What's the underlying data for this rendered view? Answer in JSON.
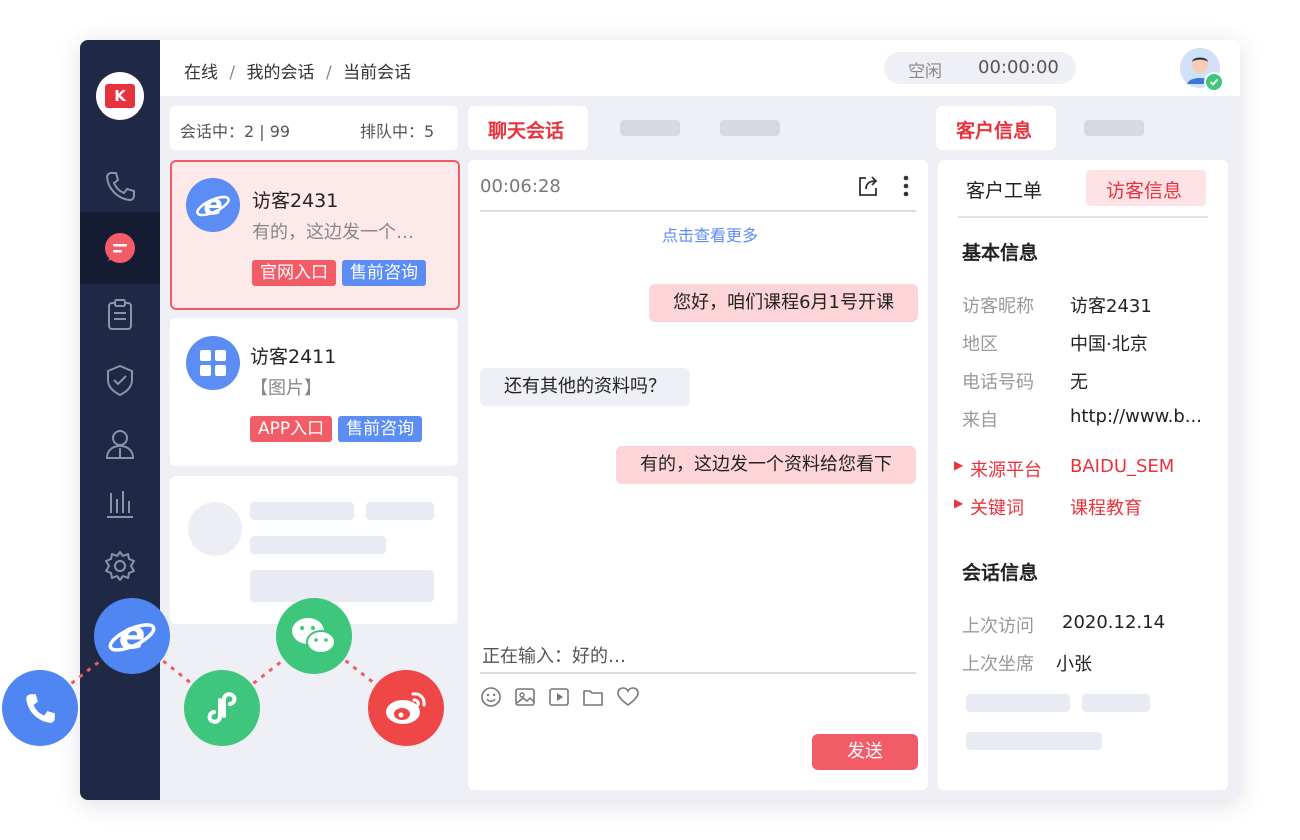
{
  "breadcrumb": {
    "item1": "在线",
    "sep1": "/",
    "item2": "我的会话",
    "sep2": "/",
    "item3": "当前会话"
  },
  "status": {
    "state": "空闲",
    "timer": "00:00:00"
  },
  "queue": {
    "in_session": "会话中：2 | 99",
    "queueing": "排队中：5"
  },
  "sessions": [
    {
      "name": "访客2431",
      "preview": "有的，这边发一个…",
      "tags": [
        "官网入口",
        "售前咨询"
      ]
    },
    {
      "name": "访客2411",
      "preview": "【图片】",
      "tags": [
        "APP入口",
        "售前咨询"
      ]
    }
  ],
  "chat_tabs": {
    "active": "聊天会话"
  },
  "chat": {
    "timer": "00:06:28",
    "load_more": "点击查看更多",
    "messages": [
      {
        "side": "right",
        "text": "您好，咱们课程6月1号开课"
      },
      {
        "side": "left",
        "text": "还有其他的资料吗？"
      },
      {
        "side": "right",
        "text": "有的，这边发一个资料给您看下"
      }
    ],
    "typing": "正在输入：好的…",
    "send_label": "发送"
  },
  "info_tabs": {
    "active": "客户信息"
  },
  "info": {
    "subtab_ticket": "客户工单",
    "subtab_visitor": "访客信息",
    "basic_title": "基本信息",
    "fields": [
      {
        "label": "访客昵称",
        "value": "访客2431"
      },
      {
        "label": "地区",
        "value": "中国·北京"
      },
      {
        "label": "电话号码",
        "value": "无"
      },
      {
        "label": "来自",
        "value": "http://www.b..."
      }
    ],
    "highlight_fields": [
      {
        "label": "来源平台",
        "value": "BAIDU_SEM"
      },
      {
        "label": "关键词",
        "value": "课程教育"
      }
    ],
    "session_title": "会话信息",
    "session_fields": [
      {
        "label": "上次访问",
        "value": "2020.12.14"
      },
      {
        "label": "上次坐席",
        "value": "小张"
      }
    ]
  },
  "colors": {
    "brand_red": "#e8333e",
    "sidebar": "#1f2845",
    "blue": "#5b8df5",
    "green": "#3ec77c"
  },
  "channel_icons": [
    "phone-icon",
    "ie-browser-icon",
    "mini-program-icon",
    "wechat-icon",
    "weibo-icon"
  ]
}
